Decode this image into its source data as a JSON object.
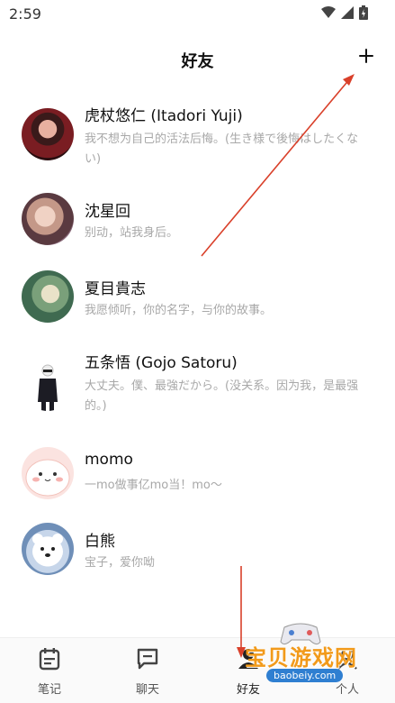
{
  "status_bar": {
    "time": "2:59"
  },
  "header": {
    "title": "好友"
  },
  "friends": [
    {
      "name": "虎杖悠仁 (Itadori Yuji)",
      "message": "我不想为自己的活法后悔。(生き様で後悔はしたくない)"
    },
    {
      "name": "沈星回",
      "message": "别动，站我身后。"
    },
    {
      "name": "夏目貴志",
      "message": "我愿倾听，你的名字，与你的故事。"
    },
    {
      "name": "五条悟 (Gojo Satoru)",
      "message": "大丈夫。僕、最強だから。(没关系。因为我，是最强的。)"
    },
    {
      "name": "momo",
      "message": "一mo做事亿mo当！mo～"
    },
    {
      "name": "白熊",
      "message": "宝子，爱你呦"
    }
  ],
  "bottom_nav": [
    {
      "label": "笔记",
      "icon": "notes-icon"
    },
    {
      "label": "聊天",
      "icon": "chat-icon"
    },
    {
      "label": "好友",
      "icon": "friends-icon"
    },
    {
      "label": "个人",
      "icon": "person-icon"
    }
  ],
  "watermark": {
    "text": "宝贝游戏网",
    "url": "baobeiy.com"
  },
  "colors": {
    "annotation_arrow": "#d9402a",
    "secondary_text": "#a8a8a8"
  }
}
